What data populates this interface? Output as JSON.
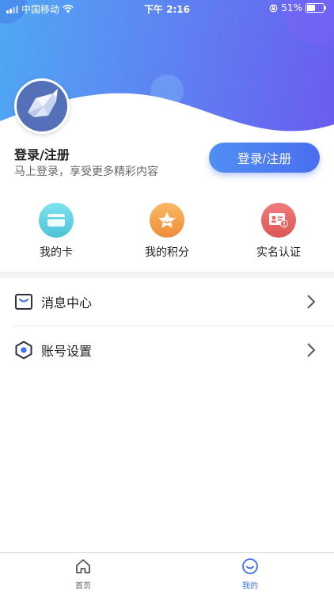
{
  "status_bar": {
    "carrier": "中国移动",
    "time": "下午 2:16",
    "battery": "51%"
  },
  "user": {
    "title": "登录/注册",
    "subtitle": "马上登录，享受更多精彩内容",
    "login_button": "登录/注册"
  },
  "quick_actions": [
    {
      "label": "我的卡",
      "icon": "card-icon",
      "color": "#5fcfe0"
    },
    {
      "label": "我的积分",
      "icon": "star-icon",
      "color": "#f5a24a"
    },
    {
      "label": "实名认证",
      "icon": "id-card-icon",
      "color": "#e86a6a"
    }
  ],
  "menu": [
    {
      "label": "消息中心",
      "icon": "message-icon"
    },
    {
      "label": "账号设置",
      "icon": "settings-icon"
    }
  ],
  "tabs": [
    {
      "label": "首页",
      "icon": "home-icon",
      "active": false
    },
    {
      "label": "我的",
      "icon": "smile-icon",
      "active": true
    }
  ],
  "colors": {
    "accent": "#4a74f0",
    "tab_active": "#3e6ff0",
    "tab_inactive": "#666666"
  }
}
